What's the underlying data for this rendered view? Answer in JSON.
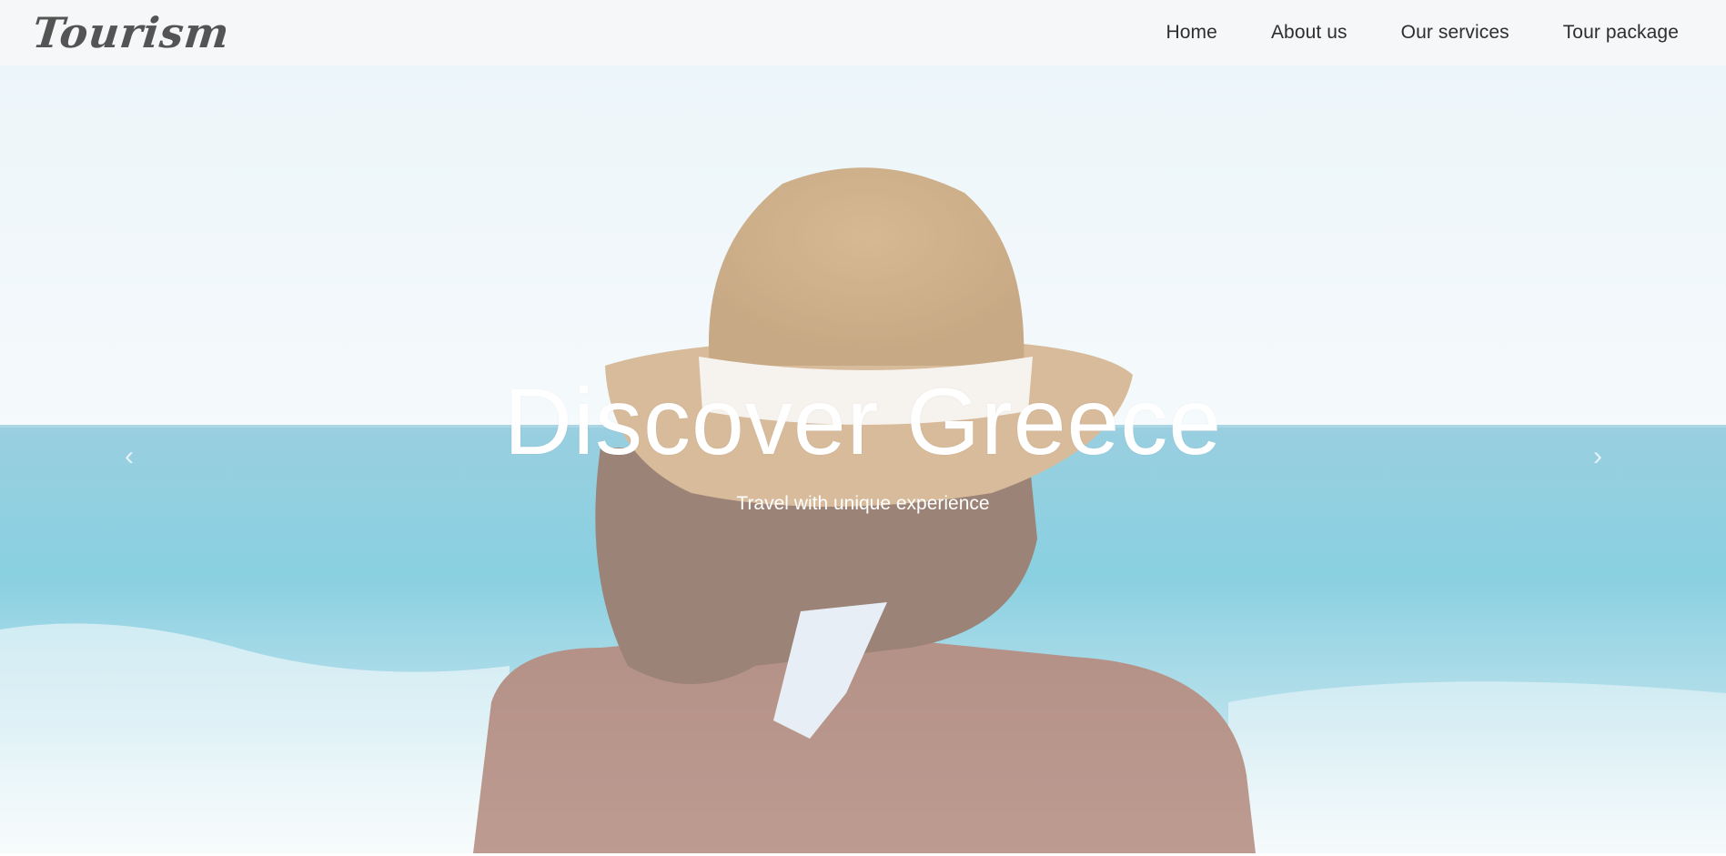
{
  "brand": {
    "name": "Tourism"
  },
  "nav": {
    "items": [
      {
        "label": "Home"
      },
      {
        "label": "About us"
      },
      {
        "label": "Our services"
      },
      {
        "label": "Tour package"
      }
    ]
  },
  "hero": {
    "title": "Discover Greece",
    "subtitle": "Travel with unique experience",
    "prev_icon": "chevron-left-icon",
    "next_icon": "chevron-right-icon",
    "prev_glyph": "‹",
    "next_glyph": "›"
  },
  "colors": {
    "sky": "#e8f3f8",
    "sea": "#5bbcd6",
    "hat": "#c9a57a",
    "navbar_bg": "#f6f7f9",
    "text_white": "#ffffff"
  }
}
